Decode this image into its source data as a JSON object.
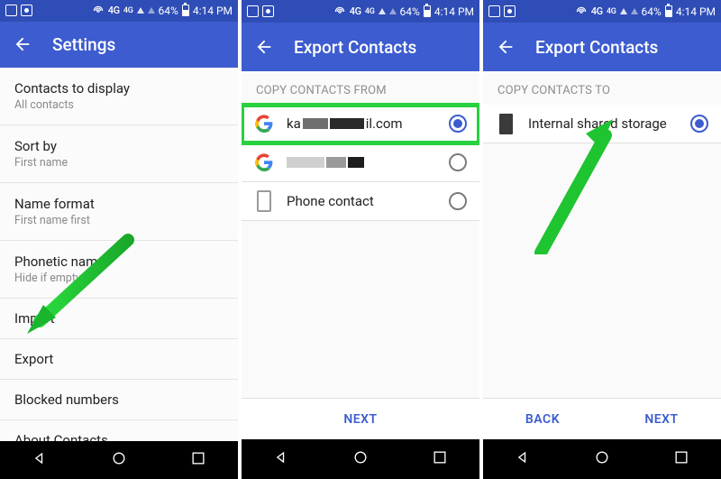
{
  "status": {
    "network": "4G",
    "net_sup": "4G",
    "battery": "64%",
    "time": "4:14 PM"
  },
  "screen1": {
    "title": "Settings",
    "items": [
      {
        "title": "Contacts to display",
        "sub": "All contacts"
      },
      {
        "title": "Sort by",
        "sub": "First name"
      },
      {
        "title": "Name format",
        "sub": "First name first"
      },
      {
        "title": "Phonetic name",
        "sub": "Hide if empty"
      },
      {
        "title": "Import"
      },
      {
        "title": "Export"
      },
      {
        "title": "Blocked numbers"
      },
      {
        "title": "About Contacts"
      }
    ]
  },
  "screen2": {
    "title": "Export Contacts",
    "section": "COPY CONTACTS FROM",
    "accounts": [
      {
        "prefix": "ka",
        "suffix": "il.com",
        "selected": true,
        "type": "google"
      },
      {
        "prefix": "",
        "suffix": "",
        "selected": false,
        "type": "google"
      },
      {
        "label": "Phone contact",
        "selected": false,
        "type": "phone"
      }
    ],
    "next": "NEXT"
  },
  "screen3": {
    "title": "Export Contacts",
    "section": "COPY CONTACTS TO",
    "dest": {
      "label": "Internal shared storage",
      "selected": true
    },
    "back": "BACK",
    "next": "NEXT"
  }
}
